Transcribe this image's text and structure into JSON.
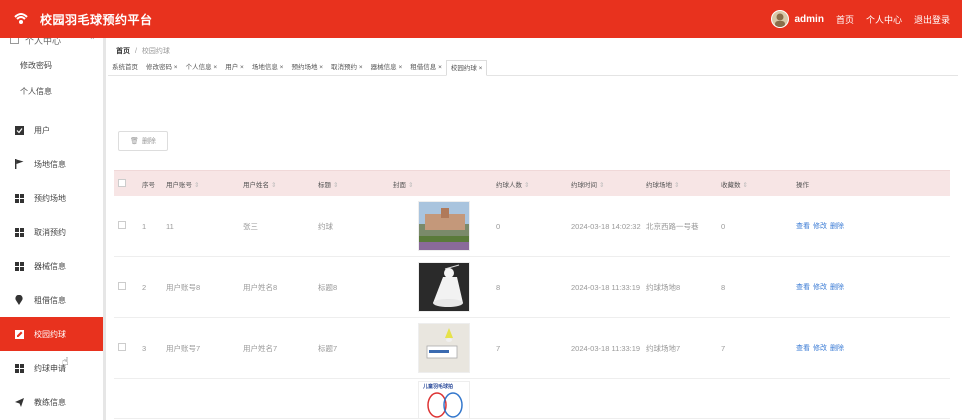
{
  "header": {
    "app_title": "校园羽毛球预约平台",
    "username": "admin",
    "links": [
      "首页",
      "个人中心",
      "退出登录"
    ]
  },
  "sidebar": {
    "group_label": "个人中心",
    "sub_items": [
      "修改密码",
      "个人信息"
    ],
    "items": [
      {
        "label": "用户",
        "icon": "checkbox-icon"
      },
      {
        "label": "场地信息",
        "icon": "flag-icon"
      },
      {
        "label": "预约场地",
        "icon": "grid-icon"
      },
      {
        "label": "取消预约",
        "icon": "grid-icon"
      },
      {
        "label": "器械信息",
        "icon": "grid-icon"
      },
      {
        "label": "租借信息",
        "icon": "location-icon"
      },
      {
        "label": "校园约球",
        "icon": "edit-icon",
        "active": true
      },
      {
        "label": "约球申请",
        "icon": "grid-icon"
      },
      {
        "label": "教练信息",
        "icon": "send-icon"
      }
    ]
  },
  "breadcrumb": {
    "home": "首页",
    "separator": "/",
    "current": "校园约球"
  },
  "tabs": [
    "系统首页",
    "修改密码 ×",
    "个人信息 ×",
    "用户 ×",
    "场地信息 ×",
    "预约场地 ×",
    "取消预约 ×",
    "器械信息 ×",
    "租借信息 ×",
    "校园约球 ×"
  ],
  "toolbar": {
    "delete_label": "删除"
  },
  "table": {
    "columns": {
      "no": "序号",
      "account": "用户账号",
      "name": "用户姓名",
      "title": "标题",
      "cover": "封面",
      "count": "约球人数",
      "time": "约球时间",
      "place": "约球场地",
      "fav": "收藏数",
      "op": "操作"
    },
    "ops": {
      "view": "查看",
      "edit": "修改",
      "delete": "删除"
    },
    "rows": [
      {
        "no": "1",
        "account": "11",
        "name": "张三",
        "title": "约球",
        "count": "0",
        "time": "2024-03-18 14:02:32",
        "place": "北京西路一号巷",
        "fav": "0"
      },
      {
        "no": "2",
        "account": "用户账号8",
        "name": "用户姓名8",
        "title": "标题8",
        "count": "8",
        "time": "2024-03-18 11:33:19",
        "place": "约球场地8",
        "fav": "8"
      },
      {
        "no": "3",
        "account": "用户账号7",
        "name": "用户姓名7",
        "title": "标题7",
        "count": "7",
        "time": "2024-03-18 11:33:19",
        "place": "约球场地7",
        "fav": "7"
      }
    ],
    "partial_row_cover_caption": "儿童羽毛球拍"
  },
  "colors": {
    "brand": "#e8321e",
    "table_header": "#f7e5e5",
    "link": "#3a7bd5"
  }
}
